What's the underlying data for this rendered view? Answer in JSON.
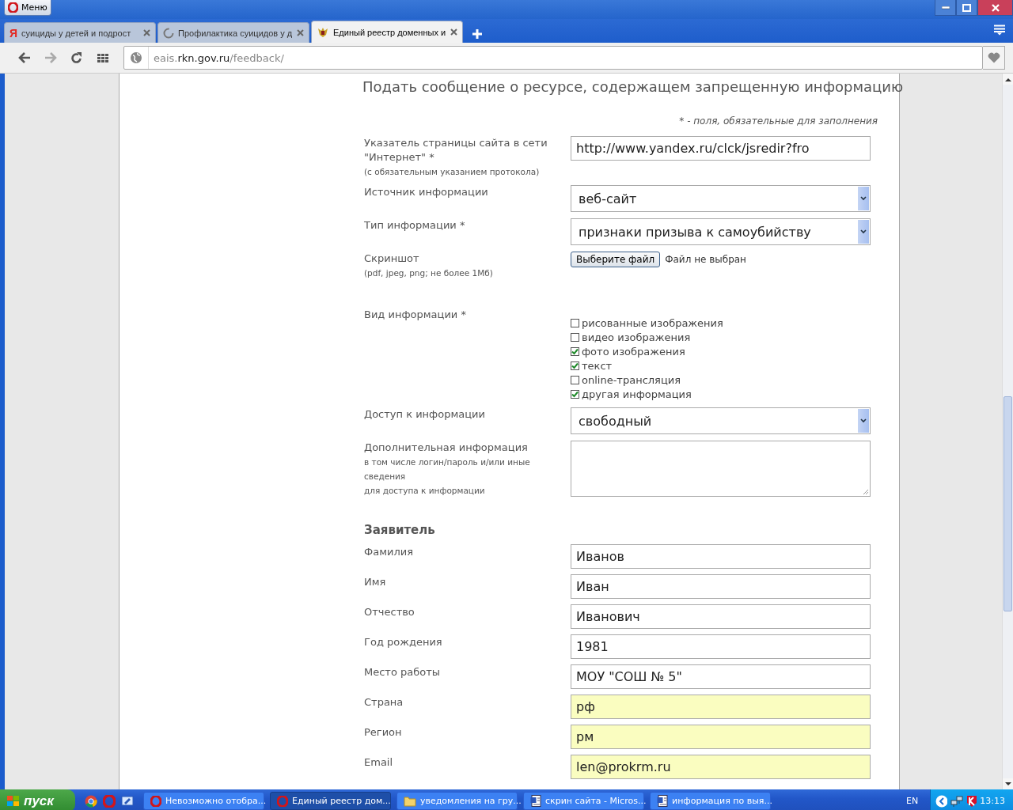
{
  "browser": {
    "menu_button": "Меню",
    "tabs": [
      {
        "kind": "letter",
        "glyph": "Я",
        "title": "суициды у детей и подрост",
        "selected": false
      },
      {
        "kind": "spinner",
        "title": "Профилактика суицидов у д",
        "selected": false
      },
      {
        "kind": "emblem",
        "title": "Единый реестр доменных и",
        "selected": true
      }
    ],
    "address": {
      "prefix": "eais.",
      "domain": "rkn.gov.ru",
      "path": "/feedback/"
    }
  },
  "page": {
    "title": "Подать сообщение о ресурсе, содержащем запрещенную информацию",
    "required_note": "* - поля, обязательные для заполнения",
    "rows": [
      {
        "kind": "text",
        "label": "Указатель страницы сайта в сети \"Интернет\" *",
        "hint": "(с обязательным указанием протокола)",
        "value": "http://www.yandex.ru/clck/jsredir?fro"
      },
      {
        "kind": "select",
        "label": "Источник информации",
        "value": "веб-сайт"
      },
      {
        "kind": "select",
        "label": "Тип информации *",
        "value": "признаки призыва к самоубийству"
      },
      {
        "kind": "file",
        "label": "Скриншот",
        "hint": "(pdf, jpeg, png; не более 1Мб)",
        "button": "Выберите файл",
        "status": "Файл не выбран"
      },
      {
        "kind": "checkboxes",
        "label": "Вид информации *",
        "options": [
          {
            "label": "рисованные изображения",
            "checked": false
          },
          {
            "label": "видео изображения",
            "checked": false
          },
          {
            "label": "фото изображения",
            "checked": true
          },
          {
            "label": "текст",
            "checked": true
          },
          {
            "label": "online-трансляция",
            "checked": false
          },
          {
            "label": "другая информация",
            "checked": true
          }
        ]
      },
      {
        "kind": "select",
        "label": "Доступ к информации",
        "value": "свободный"
      },
      {
        "kind": "textarea",
        "label": "Дополнительная информация",
        "hint_lines": [
          "в том числе логин/пароль и/или иные",
          "сведения",
          "для доступа к информации"
        ]
      }
    ],
    "applicant_heading": "Заявитель",
    "applicant_fields": [
      {
        "label": "Фамилия",
        "value": "Иванов",
        "autofilled": false
      },
      {
        "label": "Имя",
        "value": "Иван",
        "autofilled": false
      },
      {
        "label": "Отчество",
        "value": "Иванович",
        "autofilled": false
      },
      {
        "label": "Год рождения",
        "value": "1981",
        "autofilled": false
      },
      {
        "label": "Место работы",
        "value": "МОУ \"СОШ № 5\"",
        "autofilled": false
      },
      {
        "label": "Страна",
        "value": "рф",
        "autofilled": true
      },
      {
        "label": "Регион",
        "value": "рм",
        "autofilled": true
      },
      {
        "label": "Email",
        "value": "len@prokrm.ru",
        "autofilled": true
      }
    ]
  },
  "taskbar": {
    "start": "пуск",
    "tasks": [
      {
        "kind": "opera",
        "title": "Невозможно отобра...",
        "selected": false
      },
      {
        "kind": "opera",
        "title": "Единый реестр дом...",
        "selected": true
      },
      {
        "kind": "folder",
        "title": "уведомления на гру...",
        "selected": false
      },
      {
        "kind": "word",
        "title": "скрин сайта - Micros...",
        "selected": false
      },
      {
        "kind": "word",
        "title": "информация по выя...",
        "selected": false
      }
    ],
    "language": "EN",
    "clock": "13:13"
  }
}
